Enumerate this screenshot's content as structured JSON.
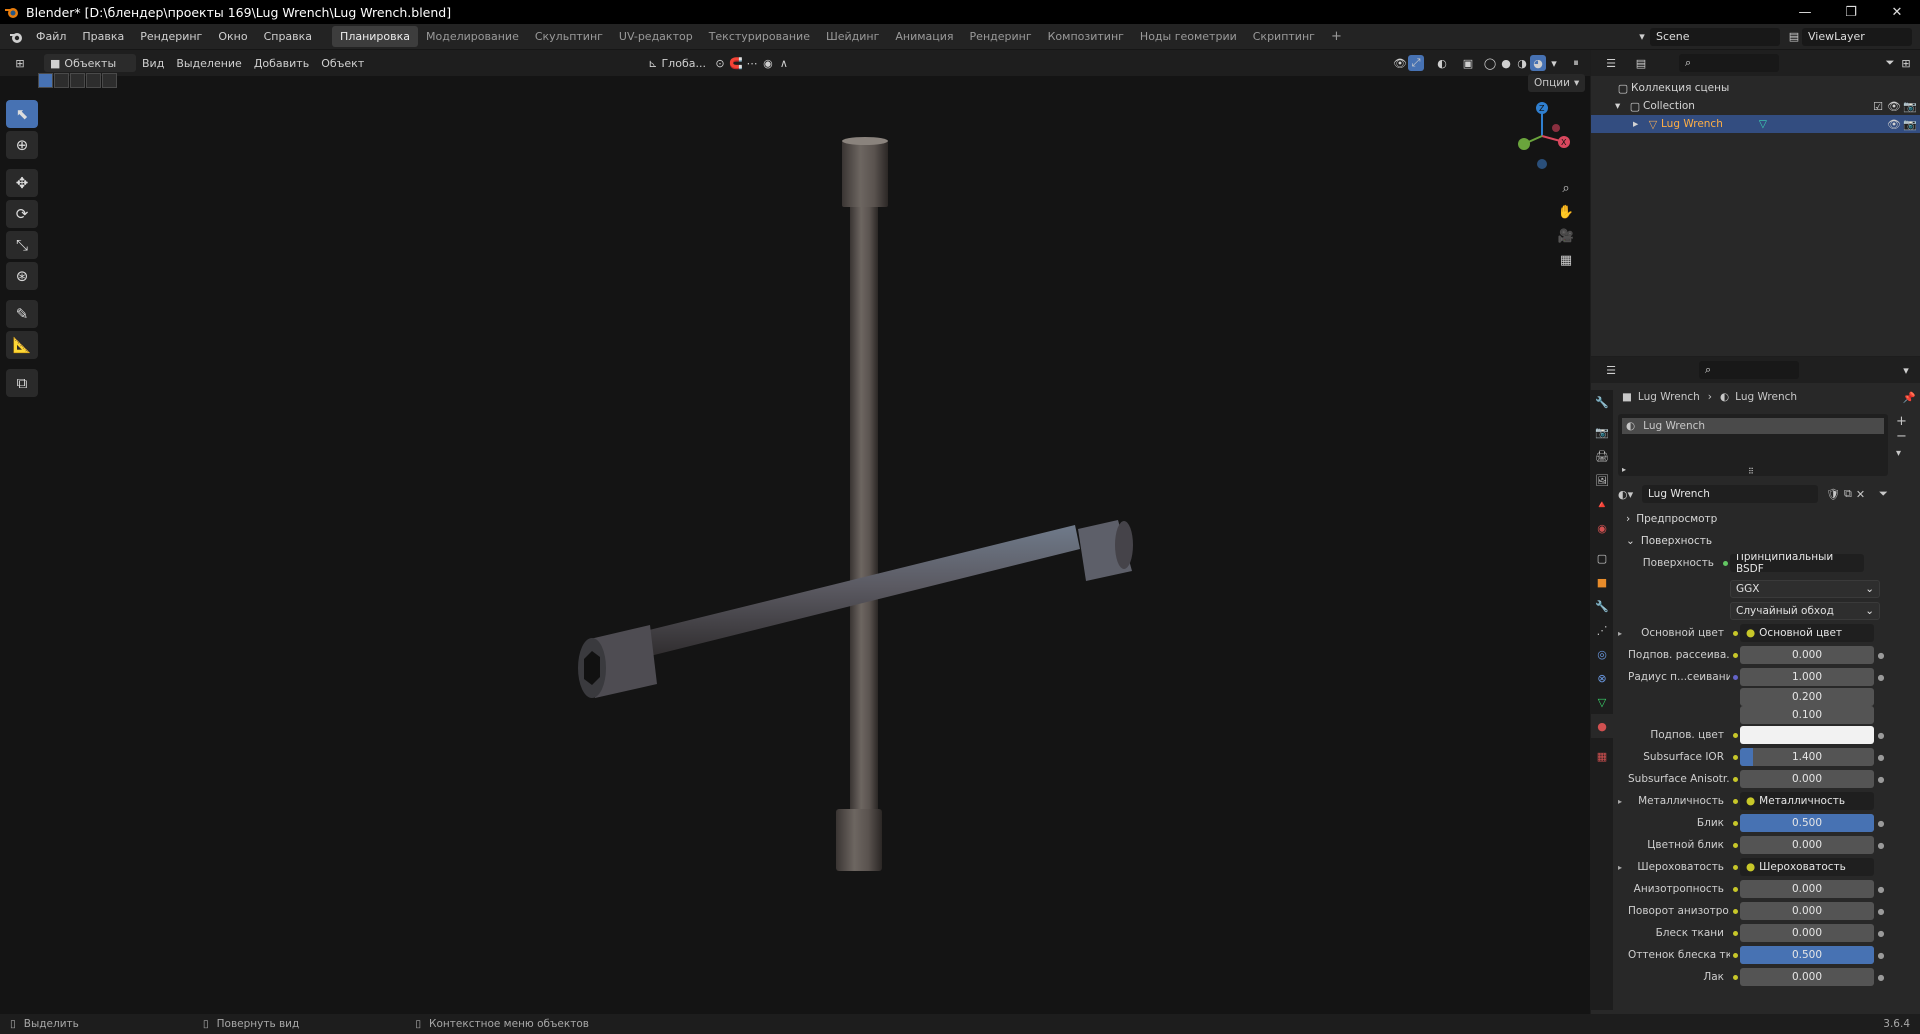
{
  "titlebar": {
    "title": "Blender* [D:\\блендер\\проекты 169\\Lug Wrench\\Lug Wrench.blend]",
    "minimize": "—",
    "maximize": "❐",
    "close": "✕"
  },
  "menu": {
    "items": [
      "Файл",
      "Правка",
      "Рендеринг",
      "Окно",
      "Справка"
    ]
  },
  "workspaces": {
    "tabs": [
      "Планировка",
      "Моделирование",
      "Скульптинг",
      "UV-редактор",
      "Текстурирование",
      "Шейдинг",
      "Анимация",
      "Рендеринг",
      "Композитинг",
      "Ноды геометрии",
      "Скриптинг"
    ],
    "active": "Планировка",
    "add": "+"
  },
  "scene": {
    "name": "Scene",
    "view_layer": "ViewLayer"
  },
  "viewport_header": {
    "mode": "Объекты",
    "menus": [
      "Вид",
      "Выделение",
      "Добавить",
      "Объект"
    ],
    "orientation": "Глоба...",
    "options": "Опции"
  },
  "outliner": {
    "root": "Коллекция сцены",
    "collection": "Collection",
    "object": "Lug Wrench"
  },
  "properties": {
    "breadcrumb_object": "Lug Wrench",
    "breadcrumb_material": "Lug Wrench",
    "slot": "Lug Wrench",
    "material_name": "Lug Wrench",
    "sections": {
      "preview": "Предпросмотр",
      "surface": "Поверхность"
    },
    "surface_label": "Поверхность",
    "surface_value": "Принципиальный BSDF",
    "distribution": "GGX",
    "subsurface_method": "Случайный обход",
    "rows": [
      {
        "label": "Основной цвет",
        "value": "Основной цвет",
        "kind": "link",
        "expand": "▸"
      },
      {
        "label": "Подпов. рассеива...",
        "value": "0.000",
        "kind": "num",
        "fill": 0
      },
      {
        "label": "Радиус п...сеивания",
        "value": "1.000",
        "kind": "num",
        "fill": 0,
        "dot": "vec"
      },
      {
        "label": "",
        "value": "0.200",
        "kind": "num",
        "fill": 0,
        "nodot": true
      },
      {
        "label": "",
        "value": "0.100",
        "kind": "num",
        "fill": 0,
        "nodot": true
      },
      {
        "label": "Подпов. цвет",
        "value": "",
        "kind": "color",
        "color": "#f2f2f2"
      },
      {
        "label": "Subsurface IOR",
        "value": "1.400",
        "kind": "num",
        "fill": 0.1
      },
      {
        "label": "Subsurface Anisotr...",
        "value": "0.000",
        "kind": "num",
        "fill": 0
      },
      {
        "label": "Металличность",
        "value": "Металличность",
        "kind": "link",
        "expand": "▸"
      },
      {
        "label": "Блик",
        "value": "0.500",
        "kind": "num",
        "fill": 1
      },
      {
        "label": "Цветной блик",
        "value": "0.000",
        "kind": "num",
        "fill": 0
      },
      {
        "label": "Шероховатость",
        "value": "Шероховатость",
        "kind": "link",
        "expand": "▸"
      },
      {
        "label": "Анизотропность",
        "value": "0.000",
        "kind": "num",
        "fill": 0
      },
      {
        "label": "Поворот анизотро...",
        "value": "0.000",
        "kind": "num",
        "fill": 0
      },
      {
        "label": "Блеск ткани",
        "value": "0.000",
        "kind": "num",
        "fill": 0
      },
      {
        "label": "Оттенок блеска тк...",
        "value": "0.500",
        "kind": "num",
        "fill": 1
      },
      {
        "label": "Лак",
        "value": "0.000",
        "kind": "num",
        "fill": 0
      }
    ]
  },
  "statusbar": {
    "select": "Выделить",
    "rotate": "Повернуть вид",
    "context": "Контекстное меню объектов",
    "version": "3.6.4"
  },
  "colors": {
    "accent": "#4772b3",
    "selection": "#334d80",
    "input_socket": "#c7c729",
    "vector_socket": "#6363c7"
  }
}
